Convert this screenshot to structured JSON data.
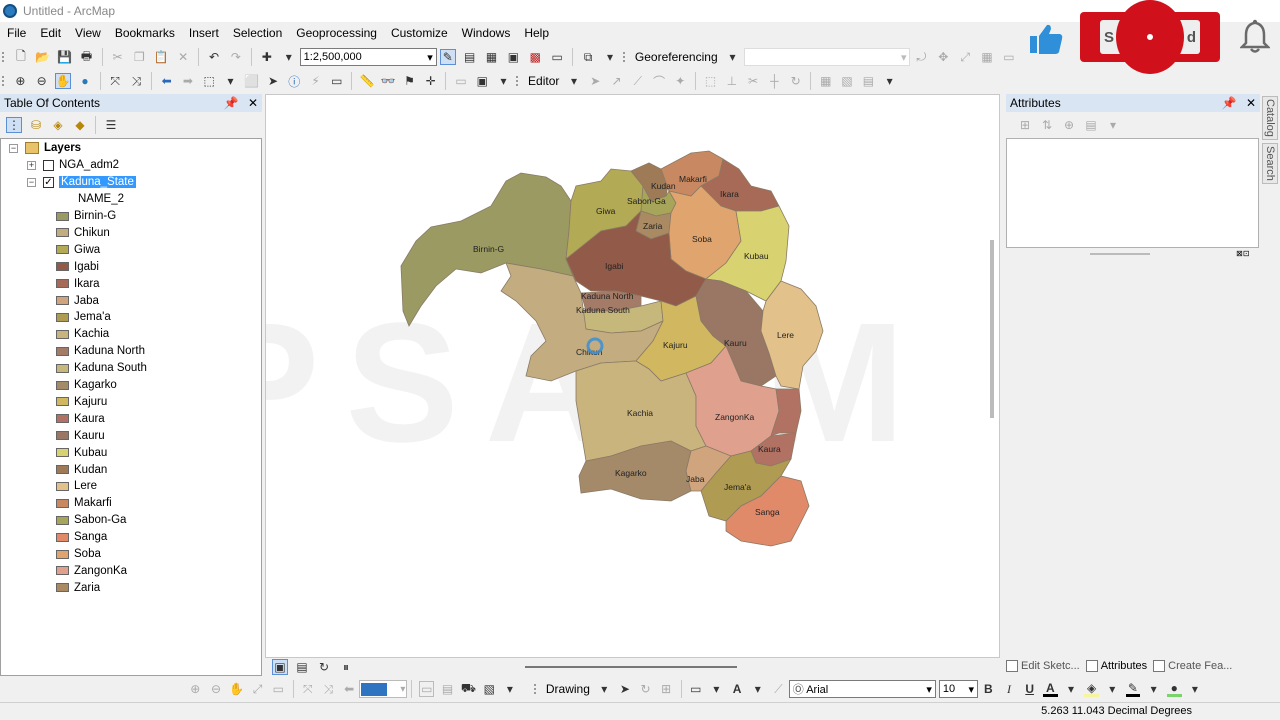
{
  "window": {
    "title": "Untitled - ArcMap"
  },
  "menu": [
    "File",
    "Edit",
    "View",
    "Bookmarks",
    "Insert",
    "Selection",
    "Geoprocessing",
    "Customize",
    "Windows",
    "Help"
  ],
  "toolbar": {
    "scale": "1:2,500,000",
    "georeferencing_label": "Georeferencing",
    "editor_label": "Editor"
  },
  "toc": {
    "title": "Table Of Contents",
    "root_label": "Layers",
    "layers": [
      {
        "name": "NGA_adm2",
        "checked": false,
        "selected": false
      },
      {
        "name": "Kaduna_State",
        "checked": true,
        "selected": true
      }
    ],
    "field_label": "NAME_2",
    "legend": [
      {
        "name": "Birnin-G",
        "color": "#9a9a62"
      },
      {
        "name": "Chikun",
        "color": "#c2ac80"
      },
      {
        "name": "Giwa",
        "color": "#b2aa55"
      },
      {
        "name": "Igabi",
        "color": "#925a48"
      },
      {
        "name": "Ikara",
        "color": "#a66a56"
      },
      {
        "name": "Jaba",
        "color": "#d0a47c"
      },
      {
        "name": "Jema'a",
        "color": "#b09b52"
      },
      {
        "name": "Kachia",
        "color": "#c9b47e"
      },
      {
        "name": "Kaduna North",
        "color": "#a47b66"
      },
      {
        "name": "Kaduna South",
        "color": "#c6b77a"
      },
      {
        "name": "Kagarko",
        "color": "#a58a6a"
      },
      {
        "name": "Kajuru",
        "color": "#d1b860"
      },
      {
        "name": "Kaura",
        "color": "#b17264"
      },
      {
        "name": "Kauru",
        "color": "#9a7664"
      },
      {
        "name": "Kubau",
        "color": "#d9d270"
      },
      {
        "name": "Kudan",
        "color": "#9e7a56"
      },
      {
        "name": "Lere",
        "color": "#e2c18a"
      },
      {
        "name": "Makarfi",
        "color": "#c78862"
      },
      {
        "name": "Sabon-Ga",
        "color": "#a7a55a"
      },
      {
        "name": "Sanga",
        "color": "#e08a6a"
      },
      {
        "name": "Soba",
        "color": "#e0a56e"
      },
      {
        "name": "ZangonKa",
        "color": "#e0a08e"
      },
      {
        "name": "Zaria",
        "color": "#aa8a62"
      }
    ]
  },
  "map": {
    "watermark": "PSALM GEO",
    "labels": {
      "birnin_g": "Birnin-G",
      "giwa": "Giwa",
      "kudan": "Kudan",
      "makarfi": "Makarfi",
      "ikara": "Ikara",
      "sabon_ga": "Sabon-Ga",
      "zaria": "Zaria",
      "soba": "Soba",
      "kubau": "Kubau",
      "igabi": "Igabi",
      "kaduna_north": "Kaduna North",
      "kaduna_south": "Kaduna South",
      "chikun": "Chikun",
      "kajuru": "Kajuru",
      "kauru": "Kauru",
      "lere": "Lere",
      "kachia": "Kachia",
      "zangonka": "ZangonKa",
      "kaura": "Kaura",
      "kagarko": "Kagarko",
      "jaba": "Jaba",
      "jema_a": "Jema'a",
      "sanga": "Sanga"
    }
  },
  "attributes": {
    "title": "Attributes",
    "tabs": [
      "Edit Sketc...",
      "Attributes",
      "Create Fea..."
    ]
  },
  "side_tabs": [
    "Catalog",
    "Search"
  ],
  "drawing": {
    "label": "Drawing",
    "font": "Arial",
    "size": "10",
    "bold": "B",
    "italic": "I",
    "underline": "U"
  },
  "overlay": {
    "subscribe_left": "S",
    "subscribe_right": "d"
  },
  "status": {
    "coordinates": "5.263  11.043 Decimal Degrees"
  }
}
